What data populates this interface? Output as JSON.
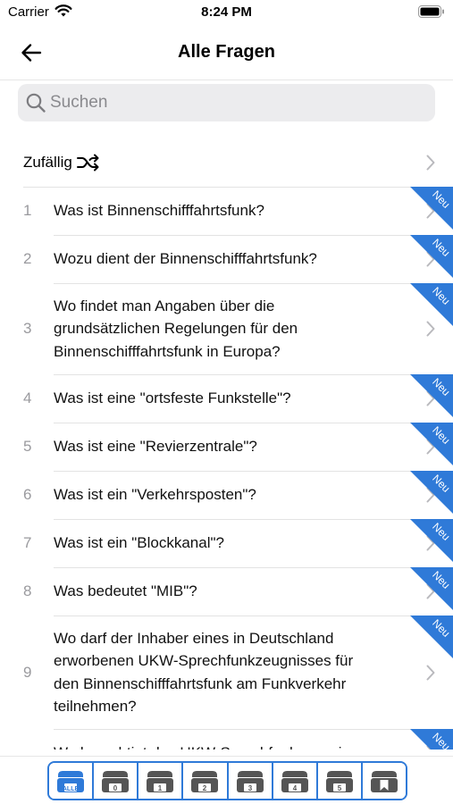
{
  "status_bar": {
    "carrier": "Carrier",
    "time": "8:24 PM"
  },
  "nav": {
    "title": "Alle Fragen"
  },
  "search": {
    "placeholder": "Suchen"
  },
  "random_row": {
    "label": "Zufällig"
  },
  "badge_label": "Neu",
  "questions": [
    {
      "number": "1",
      "lines": [
        "Was ist Binnenschifffahrtsfunk?"
      ]
    },
    {
      "number": "2",
      "lines": [
        "Wozu dient der Binnenschifffahrtsfunk?"
      ]
    },
    {
      "number": "3",
      "lines": [
        "Wo findet man Angaben über die",
        "grundsätzlichen Regelungen für den",
        "Binnenschifffahrtsfunk in Europa?"
      ]
    },
    {
      "number": "4",
      "lines": [
        "Was ist eine \"ortsfeste Funkstelle\"?"
      ]
    },
    {
      "number": "5",
      "lines": [
        "Was ist eine \"Revierzentrale\"?"
      ]
    },
    {
      "number": "6",
      "lines": [
        "Was ist ein \"Verkehrsposten\"?"
      ]
    },
    {
      "number": "7",
      "lines": [
        "Was ist ein \"Blockkanal\"?"
      ]
    },
    {
      "number": "8",
      "lines": [
        "Was bedeutet \"MIB\"?"
      ]
    },
    {
      "number": "9",
      "lines": [
        "Wo darf der Inhaber eines in Deutschland",
        "erworbenen UKW-Sprechfunkzeugnisses für",
        "den Binnenschifffahrtsfunk am Funkverkehr",
        "teilnehmen?"
      ]
    },
    {
      "number": "",
      "lines": [
        "Wo berechtigt das UKW-Sprechfunkzeugnis"
      ]
    }
  ],
  "tabs": [
    {
      "label": "ALLE",
      "selected": true
    },
    {
      "label": "0",
      "selected": false
    },
    {
      "label": "1",
      "selected": false
    },
    {
      "label": "2",
      "selected": false
    },
    {
      "label": "3",
      "selected": false
    },
    {
      "label": "4",
      "selected": false
    },
    {
      "label": "5",
      "selected": false
    },
    {
      "label": "",
      "icon": "bookmark-icon",
      "selected": false
    }
  ],
  "colors": {
    "accent": "#2f7ad8",
    "badge": "#2f7ad8",
    "divider": "#e3e3e3"
  }
}
